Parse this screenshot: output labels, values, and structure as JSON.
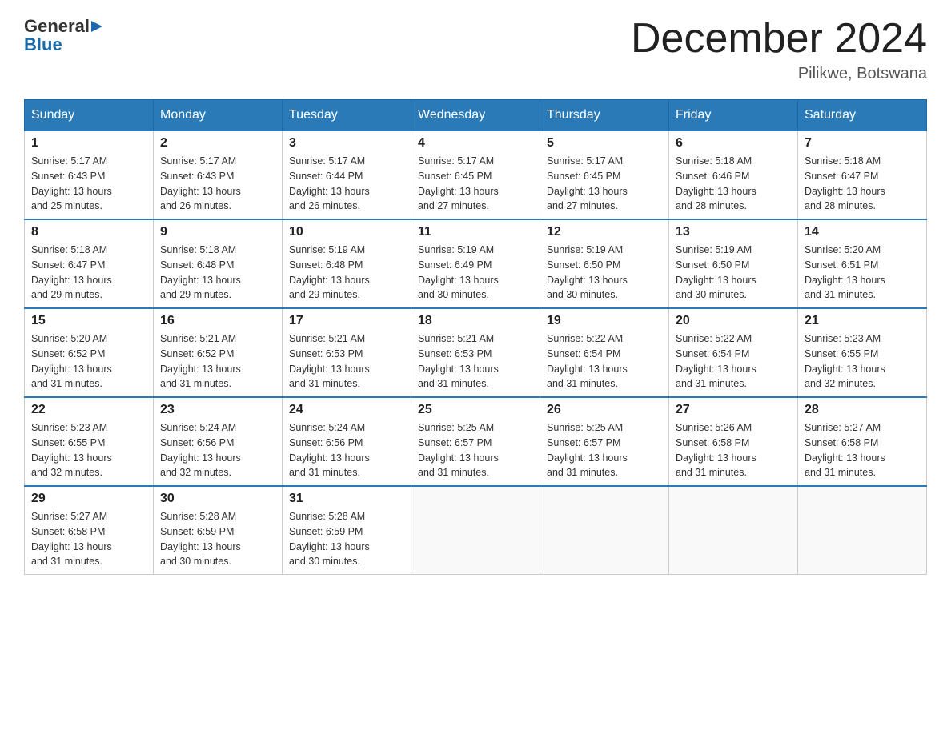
{
  "logo": {
    "general": "General",
    "blue": "Blue"
  },
  "title": "December 2024",
  "location": "Pilikwe, Botswana",
  "days_of_week": [
    "Sunday",
    "Monday",
    "Tuesday",
    "Wednesday",
    "Thursday",
    "Friday",
    "Saturday"
  ],
  "weeks": [
    [
      {
        "day": "1",
        "sunrise": "5:17 AM",
        "sunset": "6:43 PM",
        "daylight": "13 hours and 25 minutes."
      },
      {
        "day": "2",
        "sunrise": "5:17 AM",
        "sunset": "6:43 PM",
        "daylight": "13 hours and 26 minutes."
      },
      {
        "day": "3",
        "sunrise": "5:17 AM",
        "sunset": "6:44 PM",
        "daylight": "13 hours and 26 minutes."
      },
      {
        "day": "4",
        "sunrise": "5:17 AM",
        "sunset": "6:45 PM",
        "daylight": "13 hours and 27 minutes."
      },
      {
        "day": "5",
        "sunrise": "5:17 AM",
        "sunset": "6:45 PM",
        "daylight": "13 hours and 27 minutes."
      },
      {
        "day": "6",
        "sunrise": "5:18 AM",
        "sunset": "6:46 PM",
        "daylight": "13 hours and 28 minutes."
      },
      {
        "day": "7",
        "sunrise": "5:18 AM",
        "sunset": "6:47 PM",
        "daylight": "13 hours and 28 minutes."
      }
    ],
    [
      {
        "day": "8",
        "sunrise": "5:18 AM",
        "sunset": "6:47 PM",
        "daylight": "13 hours and 29 minutes."
      },
      {
        "day": "9",
        "sunrise": "5:18 AM",
        "sunset": "6:48 PM",
        "daylight": "13 hours and 29 minutes."
      },
      {
        "day": "10",
        "sunrise": "5:19 AM",
        "sunset": "6:48 PM",
        "daylight": "13 hours and 29 minutes."
      },
      {
        "day": "11",
        "sunrise": "5:19 AM",
        "sunset": "6:49 PM",
        "daylight": "13 hours and 30 minutes."
      },
      {
        "day": "12",
        "sunrise": "5:19 AM",
        "sunset": "6:50 PM",
        "daylight": "13 hours and 30 minutes."
      },
      {
        "day": "13",
        "sunrise": "5:19 AM",
        "sunset": "6:50 PM",
        "daylight": "13 hours and 30 minutes."
      },
      {
        "day": "14",
        "sunrise": "5:20 AM",
        "sunset": "6:51 PM",
        "daylight": "13 hours and 31 minutes."
      }
    ],
    [
      {
        "day": "15",
        "sunrise": "5:20 AM",
        "sunset": "6:52 PM",
        "daylight": "13 hours and 31 minutes."
      },
      {
        "day": "16",
        "sunrise": "5:21 AM",
        "sunset": "6:52 PM",
        "daylight": "13 hours and 31 minutes."
      },
      {
        "day": "17",
        "sunrise": "5:21 AM",
        "sunset": "6:53 PM",
        "daylight": "13 hours and 31 minutes."
      },
      {
        "day": "18",
        "sunrise": "5:21 AM",
        "sunset": "6:53 PM",
        "daylight": "13 hours and 31 minutes."
      },
      {
        "day": "19",
        "sunrise": "5:22 AM",
        "sunset": "6:54 PM",
        "daylight": "13 hours and 31 minutes."
      },
      {
        "day": "20",
        "sunrise": "5:22 AM",
        "sunset": "6:54 PM",
        "daylight": "13 hours and 31 minutes."
      },
      {
        "day": "21",
        "sunrise": "5:23 AM",
        "sunset": "6:55 PM",
        "daylight": "13 hours and 32 minutes."
      }
    ],
    [
      {
        "day": "22",
        "sunrise": "5:23 AM",
        "sunset": "6:55 PM",
        "daylight": "13 hours and 32 minutes."
      },
      {
        "day": "23",
        "sunrise": "5:24 AM",
        "sunset": "6:56 PM",
        "daylight": "13 hours and 32 minutes."
      },
      {
        "day": "24",
        "sunrise": "5:24 AM",
        "sunset": "6:56 PM",
        "daylight": "13 hours and 31 minutes."
      },
      {
        "day": "25",
        "sunrise": "5:25 AM",
        "sunset": "6:57 PM",
        "daylight": "13 hours and 31 minutes."
      },
      {
        "day": "26",
        "sunrise": "5:25 AM",
        "sunset": "6:57 PM",
        "daylight": "13 hours and 31 minutes."
      },
      {
        "day": "27",
        "sunrise": "5:26 AM",
        "sunset": "6:58 PM",
        "daylight": "13 hours and 31 minutes."
      },
      {
        "day": "28",
        "sunrise": "5:27 AM",
        "sunset": "6:58 PM",
        "daylight": "13 hours and 31 minutes."
      }
    ],
    [
      {
        "day": "29",
        "sunrise": "5:27 AM",
        "sunset": "6:58 PM",
        "daylight": "13 hours and 31 minutes."
      },
      {
        "day": "30",
        "sunrise": "5:28 AM",
        "sunset": "6:59 PM",
        "daylight": "13 hours and 30 minutes."
      },
      {
        "day": "31",
        "sunrise": "5:28 AM",
        "sunset": "6:59 PM",
        "daylight": "13 hours and 30 minutes."
      },
      null,
      null,
      null,
      null
    ]
  ],
  "labels": {
    "sunrise": "Sunrise:",
    "sunset": "Sunset:",
    "daylight": "Daylight:"
  }
}
